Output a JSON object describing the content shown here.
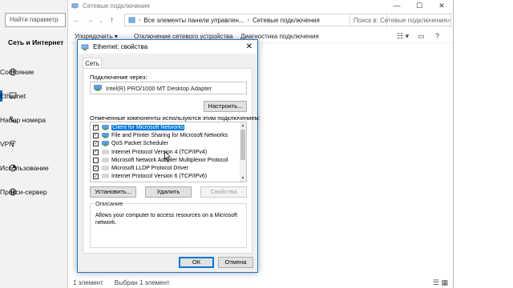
{
  "settings": {
    "search_placeholder": "Найти параметр",
    "heading": "Сеть и Интернет",
    "nav": [
      {
        "label": "Состояние",
        "icon": "globe-icon"
      },
      {
        "label": "Ethernet",
        "icon": "ethernet-icon",
        "active": true
      },
      {
        "label": "Набор номера",
        "icon": "phone-icon"
      },
      {
        "label": "VPN",
        "icon": "vpn-icon"
      },
      {
        "label": "Использование",
        "icon": "data-usage-icon"
      },
      {
        "label": "Прокси-сервер",
        "icon": "globe-icon"
      }
    ]
  },
  "explorer": {
    "title": "Сетевые подключения",
    "address": {
      "segment1": "Все элементы панели управлен...",
      "segment2": "Сетевые подключения"
    },
    "search_placeholder": "Поиск в: Сетевые подключения",
    "commands": [
      "Упорядочить ▾",
      "Отключение сетевого устройства",
      "Диагностика подключения"
    ],
    "status": {
      "count": "1 элемент",
      "selected": "Выбран 1 элемент"
    }
  },
  "dialog": {
    "title": "Ethernet: свойства",
    "tab": "Сеть",
    "connect_using_label": "Подключение через:",
    "adapter": "Intel(R) PRO/1000 MT Desktop Adapter",
    "configure_button": "Настроить...",
    "components_label": "Отмеченные компоненты используются этим подключением:",
    "components": [
      {
        "label": "Client for Microsoft Networks",
        "checked": true,
        "selected": true
      },
      {
        "label": "File and Printer Sharing for Microsoft Networks",
        "checked": true
      },
      {
        "label": "QoS Packet Scheduler",
        "checked": true
      },
      {
        "label": "Internet Protocol Version 4 (TCP/IPv4)",
        "checked": true
      },
      {
        "label": "Microsoft Network Adapter Multiplexor Protocol",
        "checked": false
      },
      {
        "label": "Microsoft LLDP Protocol Driver",
        "checked": true
      },
      {
        "label": "Internet Protocol Version 6 (TCP/IPv6)",
        "checked": true
      }
    ],
    "install_button": "Установить...",
    "uninstall_button": "Удалить",
    "properties_button": "Свойства",
    "description_legend": "Описание",
    "description_text": "Allows your computer to access resources on a Microsoft network.",
    "ok_button": "ОК",
    "cancel_button": "Отмена"
  },
  "colors": {
    "accent": "#0078d7",
    "settings_bg": "#f2f2f2",
    "dialog_border": "#1979ca"
  }
}
